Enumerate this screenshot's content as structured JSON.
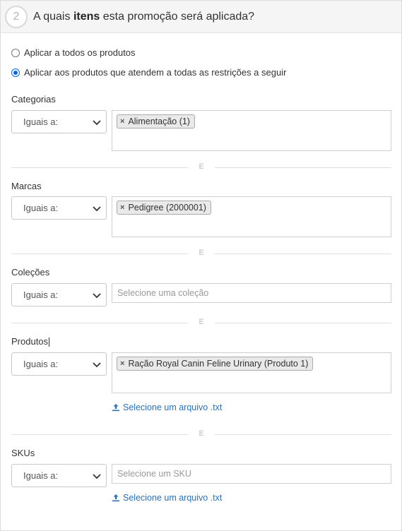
{
  "header": {
    "step_number": "2",
    "title_prefix": "A quais ",
    "title_bold": "itens",
    "title_suffix": " esta promoção será aplicada?"
  },
  "options": {
    "all_products": "Aplicar a todos os produtos",
    "restricted": "Aplicar aos produtos que atendem a todas as restrições a seguir",
    "selected": "restricted"
  },
  "separator": "E",
  "sections": {
    "categorias": {
      "label": "Categorias",
      "operator": "Iguais a:",
      "tags": [
        "Alimentação (1)"
      ]
    },
    "marcas": {
      "label": "Marcas",
      "operator": "Iguais a:",
      "tags": [
        "Pedigree (2000001)"
      ]
    },
    "colecoes": {
      "label": "Coleções",
      "operator": "Iguais a:",
      "placeholder": "Selecione uma coleção"
    },
    "produtos": {
      "label": "Produtos",
      "operator": "Iguais a:",
      "tags": [
        "Ração Royal Canin Feline Urinary (Produto 1)"
      ],
      "file_link": "Selecione um arquivo .txt"
    },
    "skus": {
      "label": "SKUs",
      "operator": "Iguais a:",
      "placeholder": "Selecione um SKU",
      "file_link": "Selecione um arquivo .txt"
    }
  },
  "colors": {
    "accent": "#0a66d6",
    "link": "#2a6fb0",
    "header_bg": "#f5f5f5"
  },
  "icons": {
    "remove": "x-icon",
    "dropdown": "chevron-down-icon",
    "upload": "upload-icon"
  }
}
